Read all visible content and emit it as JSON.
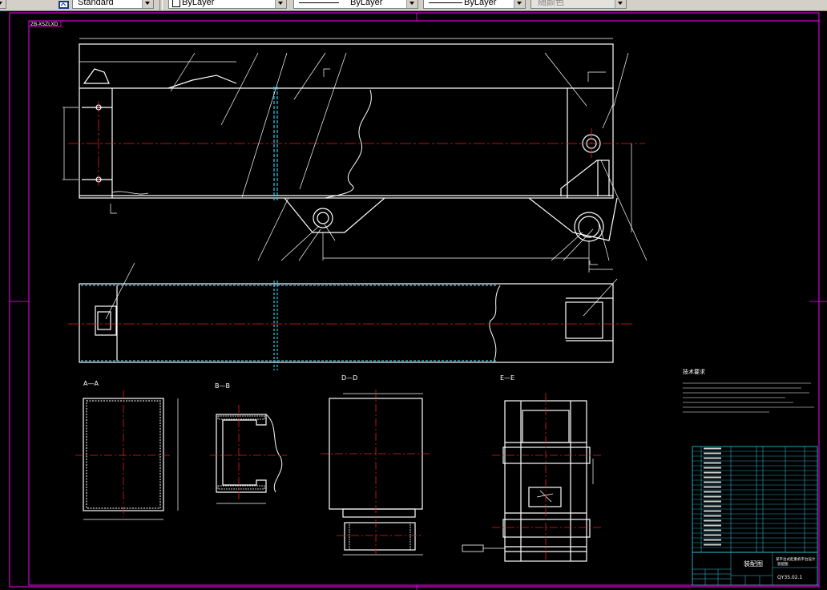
{
  "toolbar": {
    "text_style": "Standard",
    "layer": "ByLayer",
    "linetype": "ByLayer",
    "lineweight": "ByLayer",
    "plot_style": "随颜色"
  },
  "drawing": {
    "frame_code": "ZB-XSZLXD",
    "section_labels": {
      "a": "A—A",
      "b": "B—B",
      "d": "D—D",
      "e": "E—E"
    },
    "tech_requirements_title": "技术要求",
    "title_block": {
      "drawing_name": "装配图",
      "project": "某平台式起重机平台设计",
      "sheet": "装配图",
      "drawing_number": "QY35.02.1"
    }
  }
}
